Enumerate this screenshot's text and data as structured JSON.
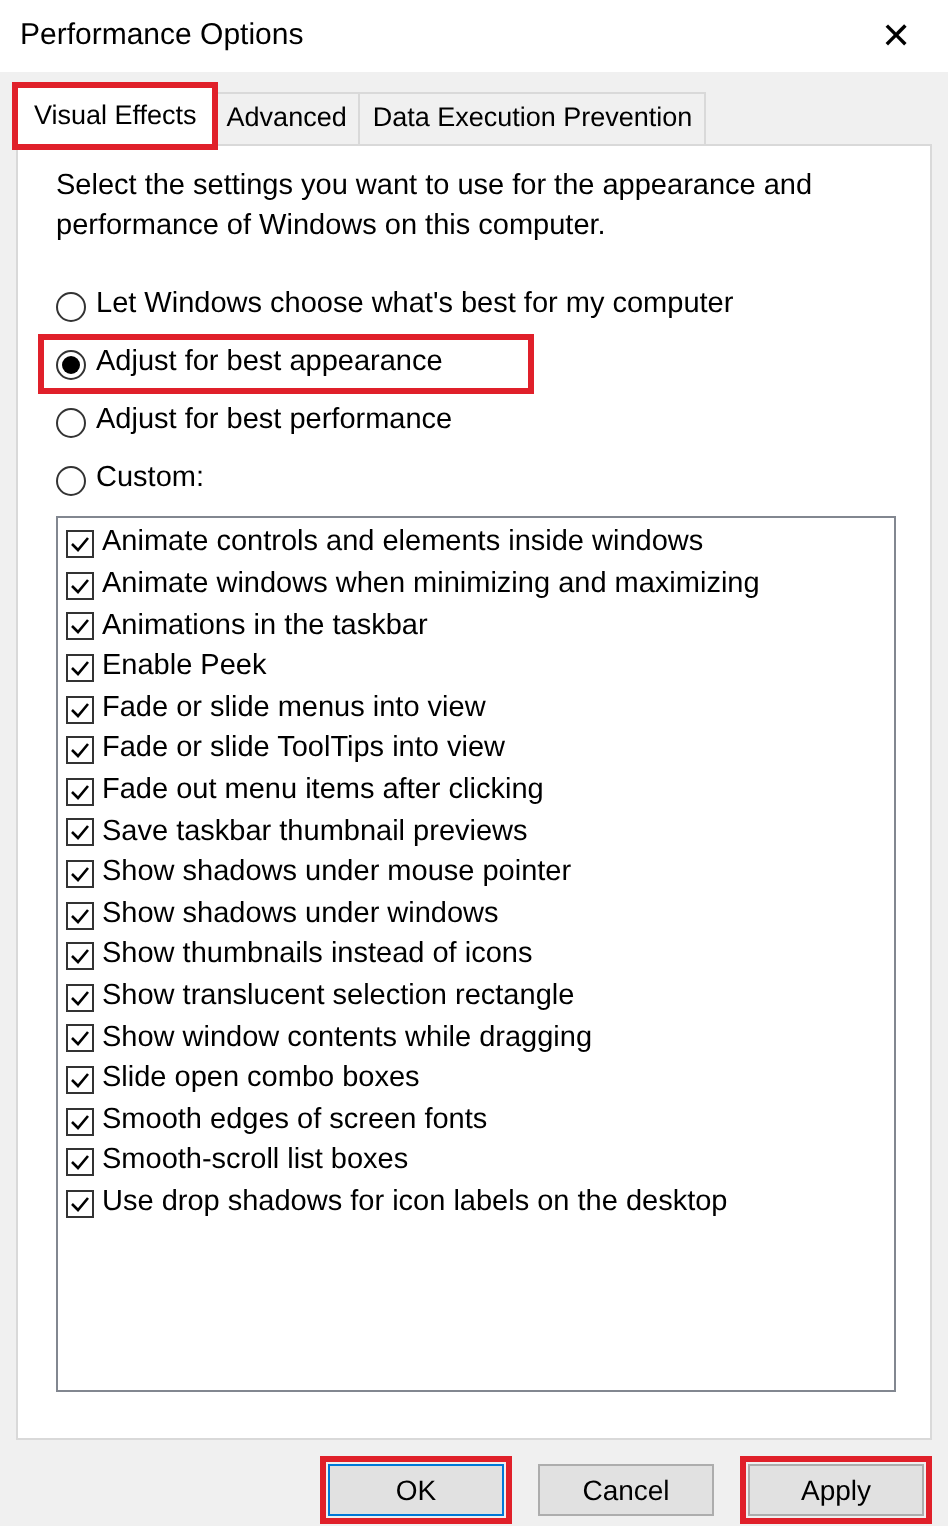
{
  "window": {
    "title": "Performance Options",
    "close": "✕"
  },
  "tabs": [
    {
      "label": "Visual Effects",
      "selected": true,
      "highlighted": true
    },
    {
      "label": "Advanced",
      "selected": false,
      "highlighted": false
    },
    {
      "label": "Data Execution Prevention",
      "selected": false,
      "highlighted": false
    }
  ],
  "description": "Select the settings you want to use for the appearance and performance of Windows on this computer.",
  "options": [
    {
      "label": "Let Windows choose what's best for my computer",
      "selected": false,
      "highlighted": false
    },
    {
      "label": "Adjust for best appearance",
      "selected": true,
      "highlighted": true
    },
    {
      "label": "Adjust for best performance",
      "selected": false,
      "highlighted": false
    },
    {
      "label": "Custom:",
      "selected": false,
      "highlighted": false
    }
  ],
  "effects": [
    {
      "label": "Animate controls and elements inside windows",
      "checked": true
    },
    {
      "label": "Animate windows when minimizing and maximizing",
      "checked": true
    },
    {
      "label": "Animations in the taskbar",
      "checked": true
    },
    {
      "label": "Enable Peek",
      "checked": true
    },
    {
      "label": "Fade or slide menus into view",
      "checked": true
    },
    {
      "label": "Fade or slide ToolTips into view",
      "checked": true
    },
    {
      "label": "Fade out menu items after clicking",
      "checked": true
    },
    {
      "label": "Save taskbar thumbnail previews",
      "checked": true
    },
    {
      "label": "Show shadows under mouse pointer",
      "checked": true
    },
    {
      "label": "Show shadows under windows",
      "checked": true
    },
    {
      "label": "Show thumbnails instead of icons",
      "checked": true
    },
    {
      "label": "Show translucent selection rectangle",
      "checked": true
    },
    {
      "label": "Show window contents while dragging",
      "checked": true
    },
    {
      "label": "Slide open combo boxes",
      "checked": true
    },
    {
      "label": "Smooth edges of screen fonts",
      "checked": true
    },
    {
      "label": "Smooth-scroll list boxes",
      "checked": true
    },
    {
      "label": "Use drop shadows for icon labels on the desktop",
      "checked": true
    }
  ],
  "buttons": [
    {
      "label": "OK",
      "focused": true,
      "highlighted": true
    },
    {
      "label": "Cancel",
      "focused": false,
      "highlighted": false
    },
    {
      "label": "Apply",
      "focused": false,
      "highlighted": true
    }
  ]
}
